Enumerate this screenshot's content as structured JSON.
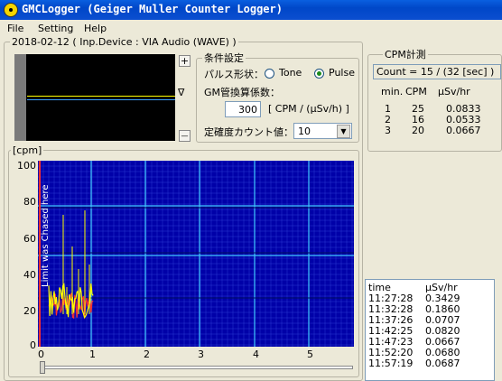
{
  "window": {
    "title": "GMCLogger (Geiger Muller Counter Logger)"
  },
  "menu": [
    "File",
    "Setting",
    "Help"
  ],
  "session": {
    "label": "2018-02-12 ( Inp.Device : VIA Audio (WAVE) )"
  },
  "scope": {
    "plus": "+",
    "minus": "—",
    "trigger": "∇"
  },
  "conditions": {
    "title": "条件設定",
    "pulse_label": "パルス形状：",
    "tone_label": "Tone",
    "pulse_option": "Pulse",
    "selected": "Pulse",
    "gm_label": "GM管換算係数：",
    "gm_value": "300",
    "gm_unit": "[ CPM / (μSv/h) ]",
    "accuracy_label": "定確度カウント値：",
    "accuracy_value": "10"
  },
  "cpm": {
    "title": "CPM計測",
    "count": "Count = 15 / (32 [sec] )",
    "headers": [
      "min.",
      "CPM",
      "μSv/hr"
    ],
    "rows": [
      [
        "1",
        "25",
        "0.0833"
      ],
      [
        "2",
        "16",
        "0.0533"
      ],
      [
        "3",
        "20",
        "0.0667"
      ]
    ]
  },
  "graph": {
    "y_unit": "[cpm]",
    "y_ticks": [
      "100",
      "80",
      "60",
      "40",
      "20",
      "0"
    ],
    "x_ticks": [
      "0",
      "1",
      "2",
      "3",
      "4",
      "5"
    ],
    "annotation": "Limit was Chased here"
  },
  "log": {
    "headers": [
      "time",
      "μSv/hr"
    ],
    "rows": [
      [
        "11:27:28",
        "0.3429"
      ],
      [
        "11:32:28",
        "0.1860"
      ],
      [
        "11:37:26",
        "0.0707"
      ],
      [
        "11:42:25",
        "0.0820"
      ],
      [
        "11:47:23",
        "0.0667"
      ],
      [
        "11:52:20",
        "0.0680"
      ],
      [
        "11:57:19",
        "0.0687"
      ]
    ]
  },
  "colors": {
    "plot_bg": "#0000a8",
    "grid": "#40c8ff",
    "line_yellow": "#ffff00",
    "line_red": "#ff3030"
  }
}
